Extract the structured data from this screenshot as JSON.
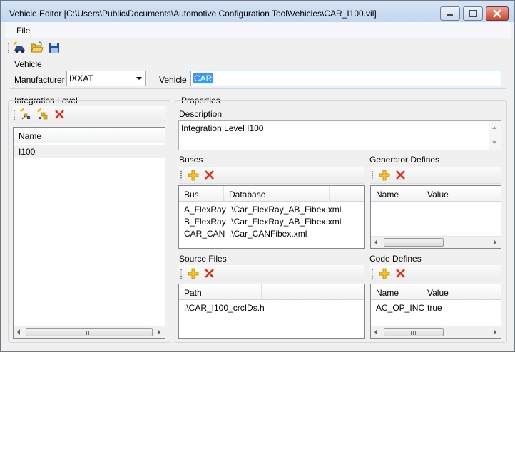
{
  "window": {
    "title": "Vehicle Editor [C:\\Users\\Public\\Documents\\Automotive Configuration Tool\\Vehicles\\CAR_I100.vil]"
  },
  "menu": {
    "file": "File"
  },
  "toolbar": {
    "icons": [
      "new-vehicle-icon",
      "open-folder-icon",
      "save-disk-icon"
    ]
  },
  "vehicle": {
    "group_label": "Vehicle",
    "manufacturer_label": "Manufacturer",
    "manufacturer_value": "IXXAT",
    "vehicle_label": "Vehicle",
    "vehicle_value": "CAR"
  },
  "integration": {
    "group_label": "Integration Level",
    "column": "Name",
    "rows": [
      "I100"
    ]
  },
  "properties": {
    "group_label": "Properties",
    "description_label": "Description",
    "description_value": "Integration Level I100",
    "buses": {
      "label": "Buses",
      "columns": [
        "Bus",
        "Database"
      ],
      "rows": [
        {
          "bus": "A_FlexRay",
          "database": ".\\Car_FlexRay_AB_Fibex.xml"
        },
        {
          "bus": "B_FlexRay",
          "database": ".\\Car_FlexRay_AB_Fibex.xml"
        },
        {
          "bus": "CAR_CAN",
          "database": ".\\Car_CANFibex.xml"
        }
      ]
    },
    "generator_defines": {
      "label": "Generator Defines",
      "columns": [
        "Name",
        "Value"
      ]
    },
    "source_files": {
      "label": "Source Files",
      "columns": [
        "Path"
      ],
      "rows": [
        ".\\CAR_I100_crcIDs.h"
      ]
    },
    "code_defines": {
      "label": "Code Defines",
      "columns": [
        "Name",
        "Value"
      ],
      "rows": [
        {
          "name": "AC_OP_INC",
          "value": "true"
        }
      ]
    }
  },
  "colors": {
    "accent_add": "#e8b00a",
    "accent_delete": "#e02b1b",
    "selection": "#3399ff",
    "titlebar": "#c9daf0"
  }
}
